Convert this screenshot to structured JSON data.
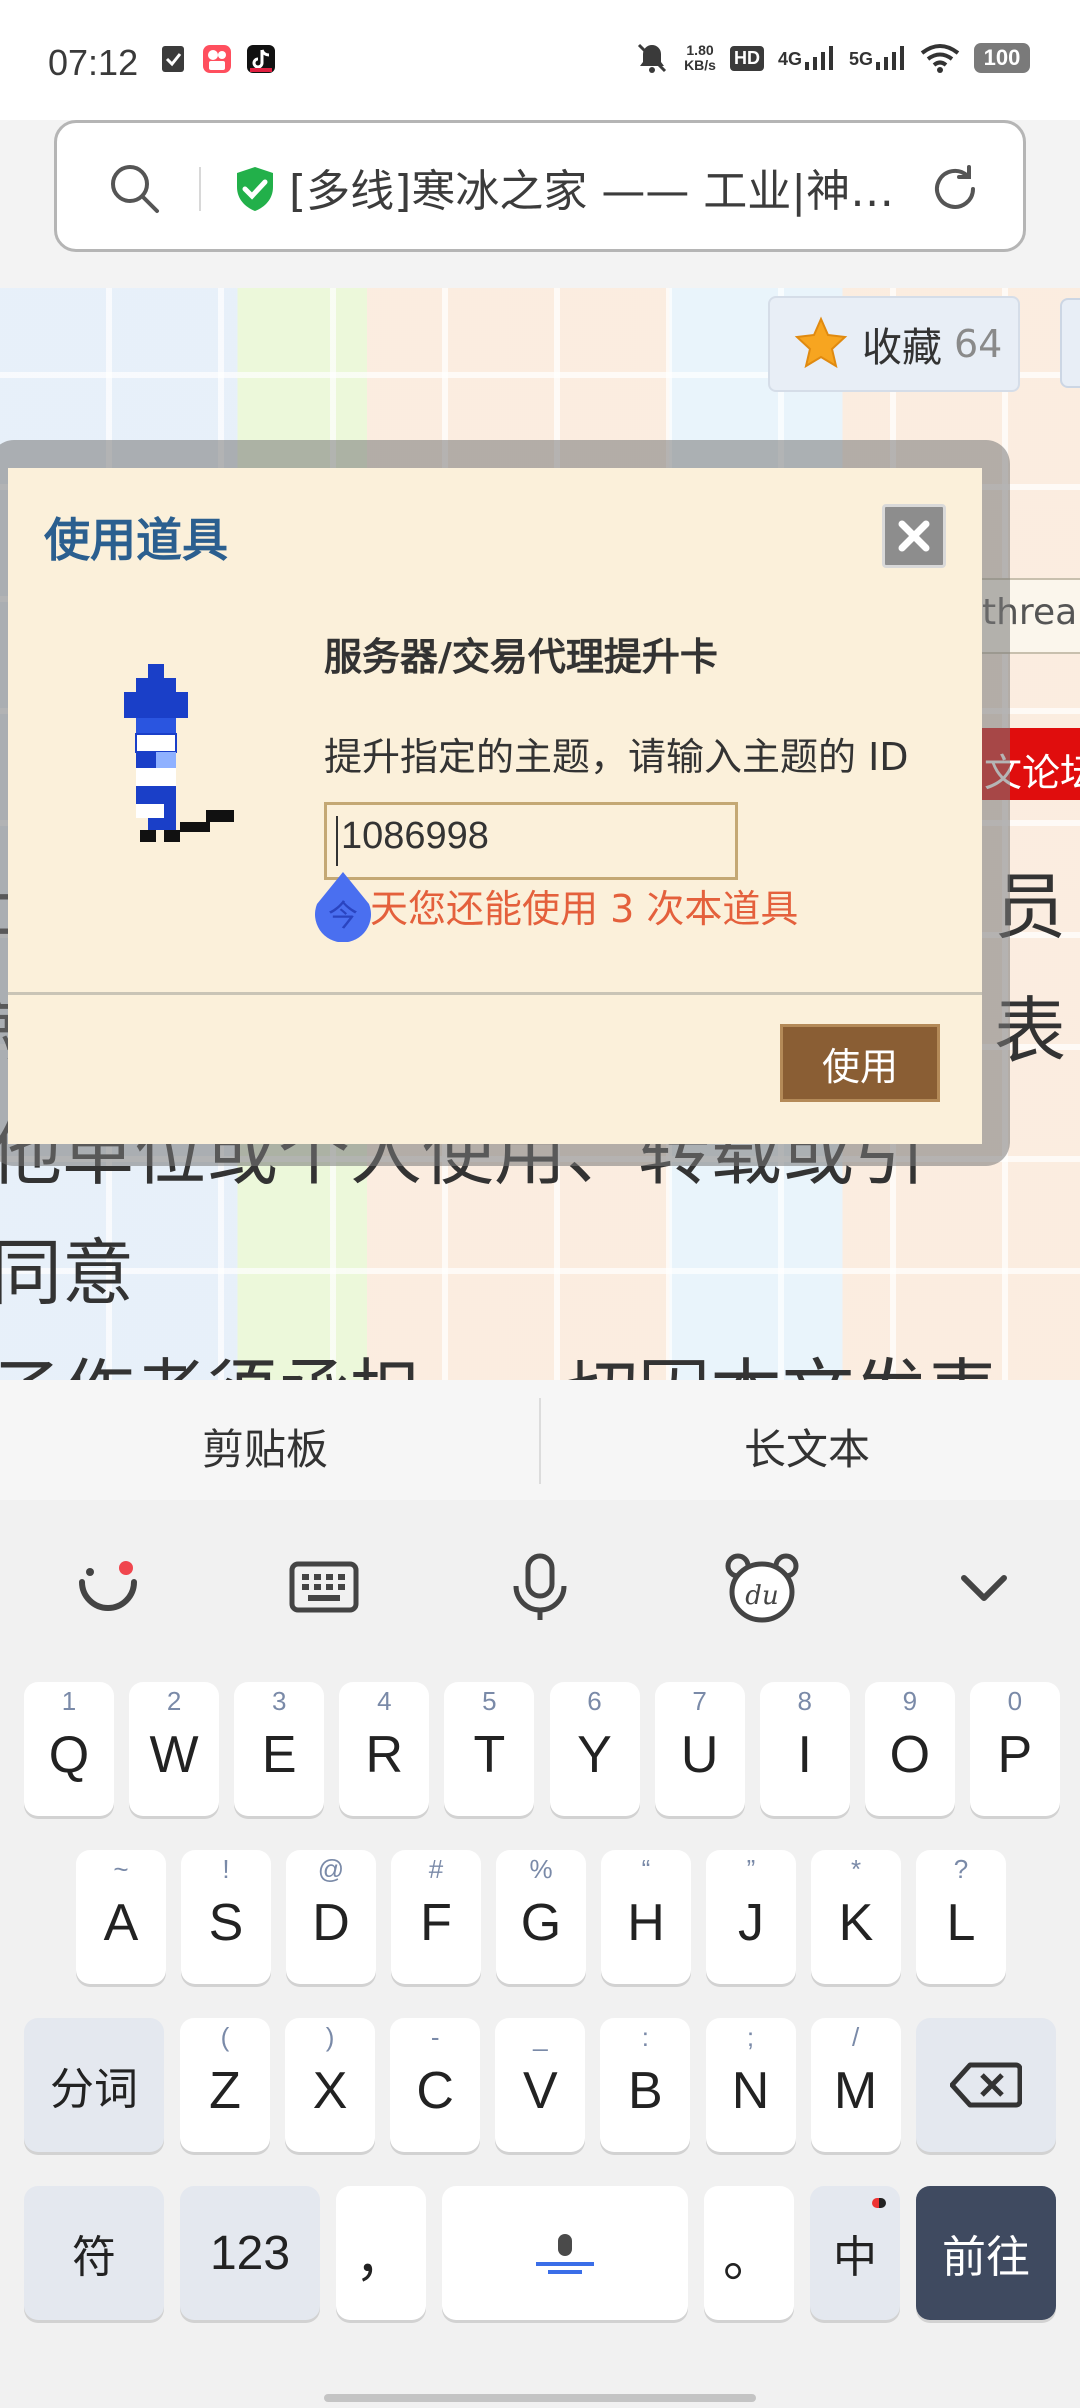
{
  "status_bar": {
    "time": "07:12",
    "speed": "1.80\nKB/s",
    "hd": "HD",
    "net1": "4G",
    "net2": "5G",
    "battery": "100",
    "icons": [
      "silent-icon",
      "hd-icon",
      "signal-4g-icon",
      "signal-5g-icon",
      "wifi-icon",
      "battery-icon"
    ]
  },
  "address_bar": {
    "title": "[多线]寒冰之家 —— 工业|神…"
  },
  "page": {
    "favorite_label": "收藏",
    "favorite_count": "64",
    "thread_fragment": "threa",
    "red_tag_fragment": "文论坛",
    "bg_lines": [
      "员",
      "表",
      "他单位或个人使用、转载或引",
      "同意",
      "子作者须承担，一切因本文发表"
    ],
    "bg_left_fragments": [
      "士",
      "就"
    ]
  },
  "dialog": {
    "title": "使用道具",
    "item_name": "服务器/交易代理提升卡",
    "description": "提升指定的主题，请输入主题的 ID",
    "input_value": "1086998",
    "note": "天您还能使用 3 次本道具",
    "use_button": "使用"
  },
  "keyboard": {
    "suggestions": [
      "剪贴板",
      "长文本"
    ],
    "tools": [
      "emoji-icon",
      "keyboard-icon",
      "microphone-icon",
      "du-icon",
      "collapse-icon"
    ],
    "row1": [
      {
        "k": "Q",
        "s": "1"
      },
      {
        "k": "W",
        "s": "2"
      },
      {
        "k": "E",
        "s": "3"
      },
      {
        "k": "R",
        "s": "4"
      },
      {
        "k": "T",
        "s": "5"
      },
      {
        "k": "Y",
        "s": "6"
      },
      {
        "k": "U",
        "s": "7"
      },
      {
        "k": "I",
        "s": "8"
      },
      {
        "k": "O",
        "s": "9"
      },
      {
        "k": "P",
        "s": "0"
      }
    ],
    "row2": [
      {
        "k": "A",
        "s": "~"
      },
      {
        "k": "S",
        "s": "!"
      },
      {
        "k": "D",
        "s": "@"
      },
      {
        "k": "F",
        "s": "#"
      },
      {
        "k": "G",
        "s": "%"
      },
      {
        "k": "H",
        "s": "“"
      },
      {
        "k": "J",
        "s": "”"
      },
      {
        "k": "K",
        "s": "*"
      },
      {
        "k": "L",
        "s": "?"
      }
    ],
    "row3": [
      {
        "k": "Z",
        "s": "("
      },
      {
        "k": "X",
        "s": ")"
      },
      {
        "k": "C",
        "s": "-"
      },
      {
        "k": "V",
        "s": "_"
      },
      {
        "k": "B",
        "s": ":"
      },
      {
        "k": "N",
        "s": ";"
      },
      {
        "k": "M",
        "s": "/"
      }
    ],
    "fenci": "分词",
    "fu": "符",
    "num": "123",
    "comma": "，",
    "period": "。",
    "zh": "中",
    "go": "前往"
  }
}
